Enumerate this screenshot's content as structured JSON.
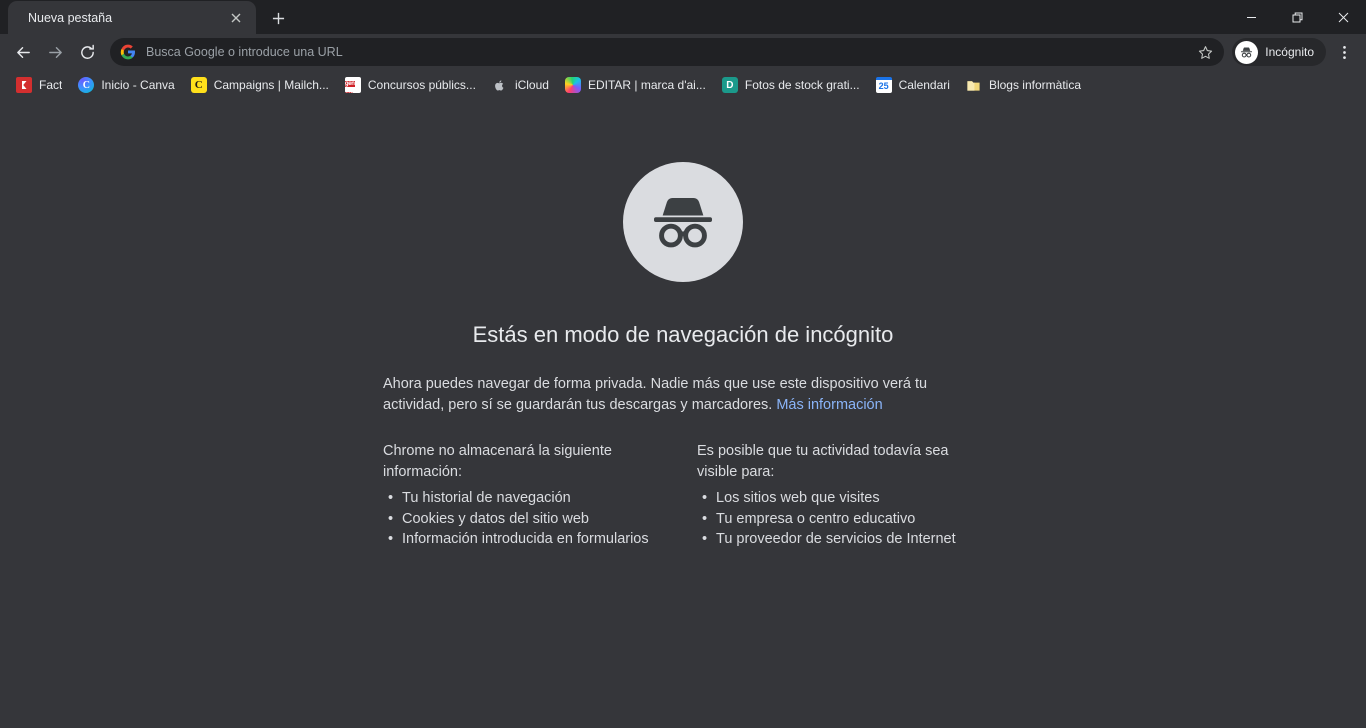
{
  "window": {
    "controls": [
      {
        "name": "minimize",
        "glyph": "minimize-icon"
      },
      {
        "name": "maximize",
        "glyph": "restore-icon"
      },
      {
        "name": "close",
        "glyph": "close-icon"
      }
    ]
  },
  "tabs": [
    {
      "title": "Nueva pestaña",
      "active": true
    }
  ],
  "newtab_button_label": "+",
  "toolbar": {
    "back_label": "Atrás",
    "forward_label": "Adelante",
    "reload_label": "Volver a cargar",
    "omnibox": {
      "placeholder": "Busca Google o introduce una URL",
      "value": "",
      "leading_icon": "google-g-icon",
      "bookmark_icon": "star-icon"
    },
    "incognito_pill_label": "Incógnito",
    "menu_label": "Personaliza y controla Google Chrome"
  },
  "bookmarks": [
    {
      "label": "Fact",
      "icon": "fact-icon"
    },
    {
      "label": "Inicio - Canva",
      "icon": "canva-icon"
    },
    {
      "label": "Campaigns | Mailch...",
      "icon": "mailchimp-icon"
    },
    {
      "label": "Concursos públics...",
      "icon": "gencat-icon",
      "icon_text_top": "gen",
      "icon_text_bottom": "cat"
    },
    {
      "label": "iCloud",
      "icon": "apple-icon",
      "icon_glyph": ""
    },
    {
      "label": "EDITAR | marca d'ai...",
      "icon": "rainbow-icon"
    },
    {
      "label": "Fotos de stock grati...",
      "icon": "depositphotos-icon",
      "icon_glyph": "D"
    },
    {
      "label": "Calendari",
      "icon": "google-calendar-icon",
      "icon_glyph": "25"
    },
    {
      "label": "Blogs informàtica",
      "icon": "folder-icon"
    }
  ],
  "page": {
    "hero_icon": "incognito-icon",
    "title": "Estás en modo de navegación de incógnito",
    "subtitle": "Ahora puedes navegar de forma privada. Nadie más que use este dispositivo verá tu actividad, pero sí se guardarán tus descargas y marcadores. ",
    "learn_more": "Más información",
    "columns": [
      {
        "heading": "Chrome no almacenará la siguiente información:",
        "items": [
          "Tu historial de navegación",
          "Cookies y datos del sitio web",
          "Información introducida en formularios"
        ]
      },
      {
        "heading": "Es posible que tu actividad todavía sea visible para:",
        "items": [
          "Los sitios web que visites",
          "Tu empresa o centro educativo",
          "Tu proveedor de servicios de Internet"
        ]
      }
    ]
  },
  "colors": {
    "window_bg": "#202124",
    "toolbar_bg": "#35363a",
    "page_bg": "#35363a",
    "omnibox_bg": "#202124",
    "text_primary": "#e8eaed",
    "text_secondary": "#dadce0",
    "text_muted": "#9aa0a6",
    "link": "#8ab4f8",
    "hero_circle": "#dadce0"
  }
}
